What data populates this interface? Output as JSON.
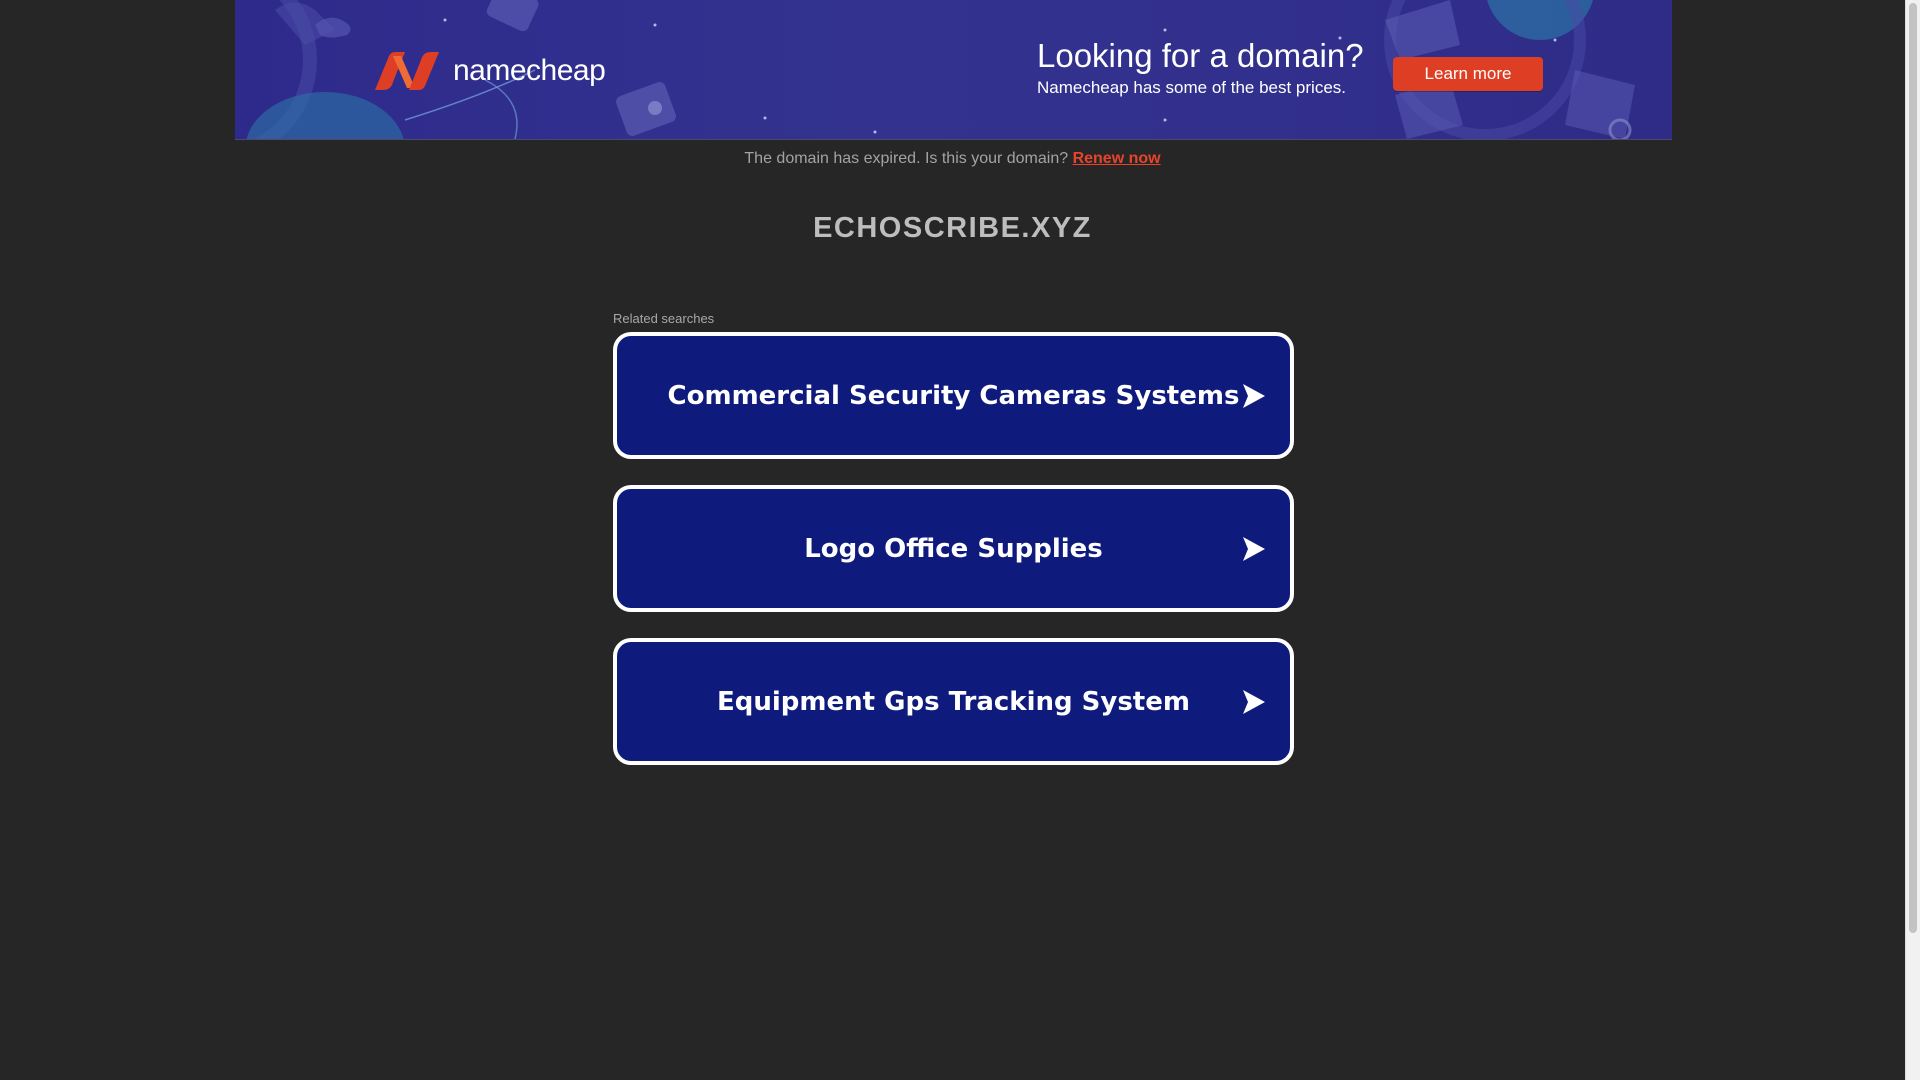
{
  "banner": {
    "logo_text": "namecheap",
    "heading": "Looking for a domain?",
    "subheading": "Namecheap has some of the best prices.",
    "cta_label": "Learn more",
    "brand_color": "#de3f24",
    "background_color": "#2e2a8c"
  },
  "notice": {
    "text": "The domain has expired. Is this your domain? ",
    "link_label": "Renew now",
    "link_color": "#e8432b"
  },
  "domain_name": "ECHOSCRIBE.XYZ",
  "related": {
    "label": "Related searches",
    "items": [
      {
        "label": "Commercial Security Cameras Systems"
      },
      {
        "label": "Logo Office Supplies"
      },
      {
        "label": "Equipment Gps Tracking System"
      }
    ],
    "button_color": "#0f1b7c",
    "icon": "arrow-right-icon"
  }
}
